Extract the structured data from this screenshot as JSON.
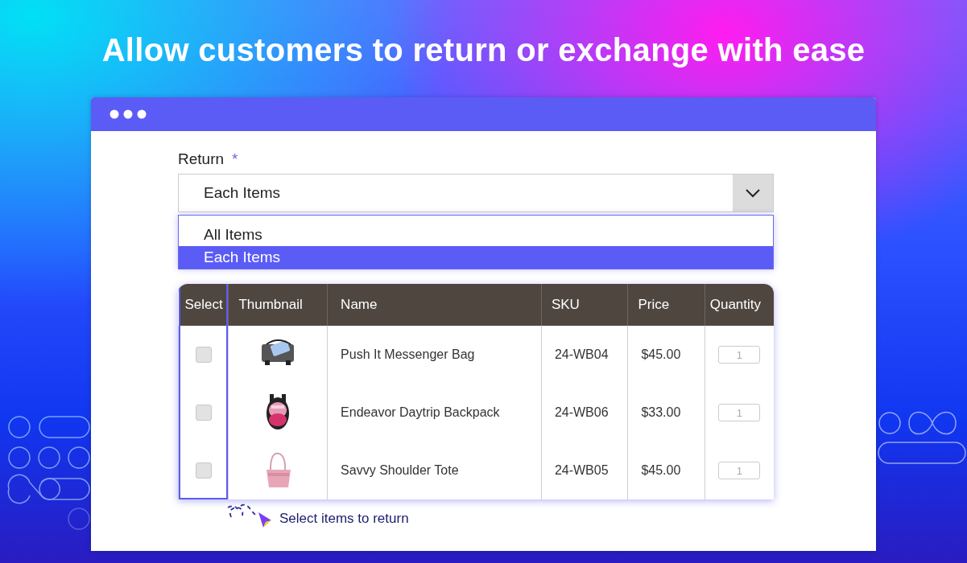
{
  "headline": "Allow customers to return or exchange with ease",
  "return_field": {
    "label": "Return",
    "required_mark": "*",
    "value": "Each Items",
    "expanded": true,
    "options": [
      {
        "label": "All Items",
        "selected": false
      },
      {
        "label": "Each Items",
        "selected": true
      }
    ]
  },
  "table": {
    "columns": [
      {
        "label": "Select",
        "highlighted": true
      },
      {
        "label": "Thumbnail",
        "highlighted": false
      },
      {
        "label": "Name",
        "highlighted": false
      },
      {
        "label": "SKU",
        "highlighted": false
      },
      {
        "label": "Price",
        "highlighted": false
      },
      {
        "label": "Quantity",
        "highlighted": false
      }
    ],
    "rows": [
      {
        "checked": false,
        "name": "Push It Messenger Bag",
        "sku": "24-WB04",
        "price": "$45.00",
        "quantity": "1"
      },
      {
        "checked": false,
        "name": "Endeavor Daytrip Backpack",
        "sku": "24-WB06",
        "price": "$33.00",
        "quantity": "1"
      },
      {
        "checked": false,
        "name": "Savvy Shoulder Tote",
        "sku": "24-WB05",
        "price": "$45.00",
        "quantity": "1"
      }
    ]
  },
  "hint": "Select items to return"
}
